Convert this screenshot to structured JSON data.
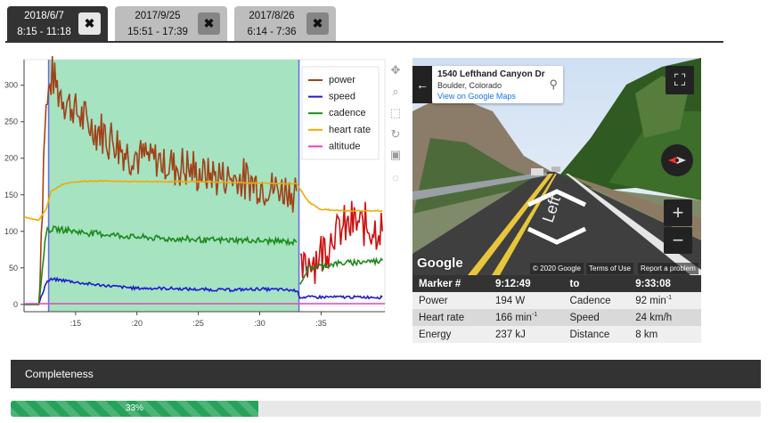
{
  "tabs": [
    {
      "date": "2018/6/7",
      "time": "8:15 - 11:18",
      "active": true
    },
    {
      "date": "2017/9/25",
      "time": "15:51 - 17:39",
      "active": false
    },
    {
      "date": "2017/8/26",
      "time": "6:14 - 7:36",
      "active": false
    }
  ],
  "close_glyph": "✖",
  "chart_data": {
    "type": "line",
    "x_tick_labels": [
      ":15",
      ":20",
      ":25",
      ":30",
      ":35"
    ],
    "x_ticks_minutes": [
      15,
      20,
      25,
      30,
      35
    ],
    "xlim_minutes": [
      10.8,
      40.2
    ],
    "ylim": [
      -10,
      335
    ],
    "y_ticks": [
      0,
      50,
      100,
      150,
      200,
      250,
      300
    ],
    "selection_minutes": [
      12.8,
      33.2
    ],
    "selection_color": "#a6e3c1",
    "legend": {
      "position": "top-right",
      "entries": [
        {
          "label": "power",
          "color": "#a0421a"
        },
        {
          "label": "speed",
          "color": "#1c1cc8"
        },
        {
          "label": "cadence",
          "color": "#1a8a1a"
        },
        {
          "label": "heart rate",
          "color": "#f2a900"
        },
        {
          "label": "altitude",
          "color": "#ee3fbe"
        }
      ]
    },
    "series": [
      {
        "name": "power",
        "color": "#a0421a",
        "x": [
          10.8,
          12.0,
          12.5,
          13.0,
          14.0,
          15.0,
          16.0,
          17.0,
          18.0,
          19.0,
          20.0,
          21.0,
          22.0,
          23.0,
          24.0,
          25.0,
          26.0,
          27.0,
          28.0,
          29.0,
          30.0,
          31.0,
          32.0,
          33.0
        ],
        "y": [
          0,
          0,
          250,
          310,
          285,
          265,
          245,
          240,
          225,
          210,
          205,
          200,
          195,
          190,
          185,
          180,
          178,
          175,
          172,
          168,
          165,
          160,
          155,
          155
        ]
      },
      {
        "name": "power",
        "color": "#cc1111",
        "x": [
          33.3,
          34.0,
          35.0,
          36.0,
          37.0,
          38.0,
          39.0,
          40.0
        ],
        "y": [
          40,
          60,
          70,
          95,
          105,
          110,
          105,
          100
        ]
      },
      {
        "name": "speed",
        "color": "#1c1cc8",
        "x": [
          10.8,
          12.0,
          12.6,
          13.0,
          14.0,
          16.0,
          18.0,
          20.0,
          22.0,
          24.0,
          26.0,
          28.0,
          30.0,
          32.0,
          33.0,
          33.3,
          35.0,
          38.0,
          40.0
        ],
        "y": [
          0,
          0,
          30,
          34,
          33,
          28,
          25,
          22,
          22,
          21,
          20,
          20,
          21,
          20,
          19,
          10,
          10,
          10,
          10
        ]
      },
      {
        "name": "cadence",
        "color": "#1a8a1a",
        "x": [
          10.8,
          12.0,
          12.6,
          13.0,
          14.0,
          16.0,
          18.0,
          20.0,
          22.0,
          24.0,
          26.0,
          28.0,
          30.0,
          32.0,
          33.0
        ],
        "y": [
          0,
          0,
          100,
          103,
          102,
          98,
          95,
          92,
          90,
          89,
          88,
          88,
          87,
          86,
          85
        ]
      },
      {
        "name": "cadence",
        "color": "#1a8a1a",
        "x": [
          33.3,
          34.0,
          36.0,
          38.0,
          40.0
        ],
        "y": [
          30,
          50,
          55,
          58,
          60
        ]
      },
      {
        "name": "heart rate",
        "color": "#f2a900",
        "x": [
          10.8,
          12.0,
          12.6,
          13.0,
          14.0,
          15.0,
          17.0,
          20.0,
          25.0,
          30.0,
          33.0,
          34.0,
          35.0,
          37.0,
          40.0
        ],
        "y": [
          120,
          115,
          130,
          155,
          165,
          168,
          169,
          168,
          168,
          166,
          165,
          140,
          130,
          128,
          128
        ]
      },
      {
        "name": "altitude",
        "color": "#ee3fbe",
        "x": [
          10.8,
          40.2
        ],
        "y": [
          1,
          1
        ]
      }
    ]
  },
  "street_view": {
    "address": "1540 Lefthand Canyon Dr",
    "city": "Boulder, Colorado",
    "link": "View on Google Maps",
    "logo": "Google",
    "copyright": "© 2020 Google",
    "terms": "Terms of Use",
    "report": "Report a problem",
    "road_label": "Left",
    "back_icon": "←",
    "pin_icon": "⚲",
    "fullscreen_icon": "⛶",
    "zoom_in": "+",
    "zoom_out": "−"
  },
  "summary": {
    "header": [
      "Marker #",
      "9:12:49",
      "to",
      "9:33:08"
    ],
    "rows": [
      [
        {
          "t": "Power"
        },
        {
          "t": "194 W"
        },
        {
          "t": "Cadence"
        },
        {
          "t": "92 min",
          "sup": "-1"
        }
      ],
      [
        {
          "t": "Heart rate"
        },
        {
          "t": "166 min",
          "sup": "-1"
        },
        {
          "t": "Speed"
        },
        {
          "t": "24 km/h"
        }
      ],
      [
        {
          "t": "Energy"
        },
        {
          "t": "237 kJ"
        },
        {
          "t": "Distance"
        },
        {
          "t": "8 km"
        }
      ]
    ]
  },
  "completeness": {
    "label": "Completeness",
    "progress_text": "33%",
    "progress_fraction": 0.33
  }
}
